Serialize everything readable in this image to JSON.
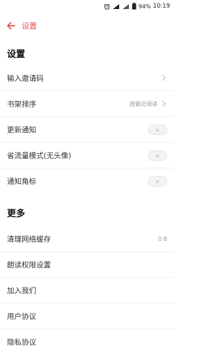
{
  "status_bar": {
    "battery": "94%",
    "time": "10:19"
  },
  "header": {
    "title": "设置"
  },
  "sections": {
    "settings_title": "设置",
    "more_title": "更多"
  },
  "settings_rows": {
    "invite": {
      "label": "输入邀请码"
    },
    "shelf_sort": {
      "label": "书架排序",
      "value": "按最近阅读"
    },
    "update_notify": {
      "label": "更新通知",
      "toggle_on": false
    },
    "data_saver": {
      "label": "省流量模式(无头像)",
      "toggle_on": false
    },
    "badge": {
      "label": "通知角标",
      "toggle_on": false
    }
  },
  "more_rows": {
    "clear_cache": {
      "label": "清理网络缓存",
      "value": "0 B"
    },
    "read_aloud": {
      "label": "朗读权限设置"
    },
    "join_us": {
      "label": "加入我们"
    },
    "user_agreement": {
      "label": "用户协议"
    },
    "privacy": {
      "label": "隐私协议"
    }
  },
  "colors": {
    "accent": "#e8554e"
  },
  "icons": [
    "alarm-icon",
    "signal-icon",
    "battery-icon",
    "back-arrow-icon",
    "chevron-right-icon"
  ]
}
